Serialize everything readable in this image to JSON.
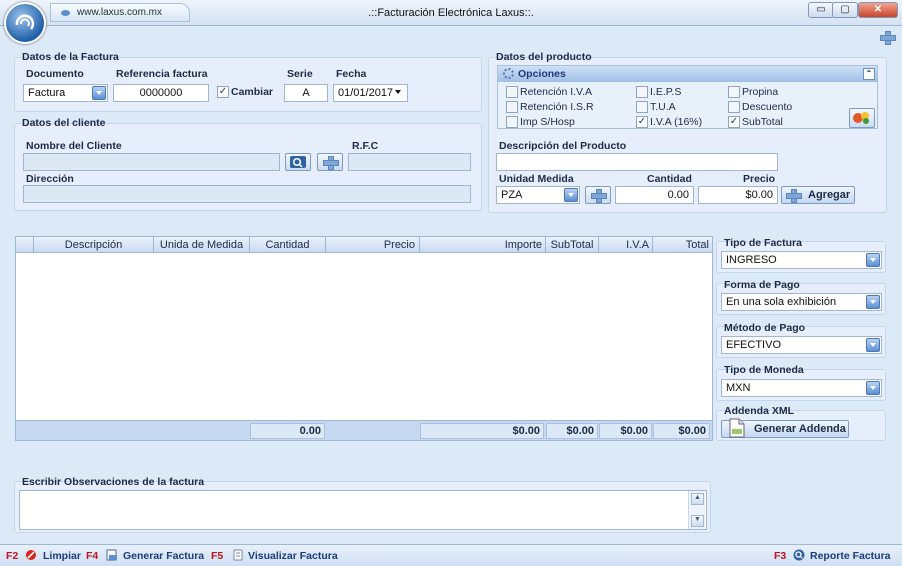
{
  "window": {
    "url": "www.laxus.com.mx",
    "title": ".::Facturación Electrónica Laxus::.",
    "minimize": "▭",
    "maximize": "▢",
    "close": "✕"
  },
  "factura": {
    "title": "Datos de la Factura",
    "documento_label": "Documento",
    "documento_value": "Factura",
    "referencia_label": "Referencia factura",
    "referencia_value": "0000000",
    "cambiar_label": "Cambiar",
    "cambiar_checked": true,
    "serie_label": "Serie",
    "serie_value": "A",
    "fecha_label": "Fecha",
    "fecha_value": "01/01/2017"
  },
  "cliente": {
    "title": "Datos del cliente",
    "nombre_label": "Nombre del Cliente",
    "nombre_value": "",
    "rfc_label": "R.F.C",
    "rfc_value": "",
    "direccion_label": "Dirección",
    "direccion_value": ""
  },
  "producto": {
    "title": "Datos del producto",
    "opciones_title": "Opciones",
    "options": [
      {
        "label": "Retención I.V.A",
        "checked": false
      },
      {
        "label": "Retención I.S.R",
        "checked": false
      },
      {
        "label": "Imp S/Hosp",
        "checked": false
      },
      {
        "label": "I.E.P.S",
        "checked": false
      },
      {
        "label": "T.U.A",
        "checked": false
      },
      {
        "label": "I.V.A (16%)",
        "checked": true
      },
      {
        "label": "Propina",
        "checked": false
      },
      {
        "label": "Descuento",
        "checked": false
      },
      {
        "label": "SubTotal",
        "checked": true
      }
    ],
    "descripcion_label": "Descripción del Producto",
    "descripcion_value": "",
    "unidad_label": "Unidad Medida",
    "unidad_value": "PZA",
    "cantidad_label": "Cantidad",
    "cantidad_value": "0.00",
    "precio_label": "Precio",
    "precio_value": "$0.00",
    "agregar_label": "Agregar"
  },
  "table": {
    "columns": [
      "Descripción",
      "Unida de Medida",
      "Cantidad",
      "Precio",
      "Importe",
      "SubTotal",
      "I.V.A",
      "Total"
    ],
    "rows": [],
    "totals": {
      "cantidad": "0.00",
      "importe": "$0.00",
      "subtotal": "$0.00",
      "iva": "$0.00",
      "total": "$0.00"
    }
  },
  "side": {
    "tipo_factura_label": "Tipo de Factura",
    "tipo_factura_value": "INGRESO",
    "forma_pago_label": "Forma de Pago",
    "forma_pago_value": "En una sola exhibición",
    "metodo_pago_label": "Método de Pago",
    "metodo_pago_value": "EFECTIVO",
    "moneda_label": "Tipo de Moneda",
    "moneda_value": "MXN",
    "addenda_label": "Addenda XML",
    "addenda_button": "Generar Addenda"
  },
  "observaciones": {
    "title": "Escribir Observaciones de la factura",
    "value": ""
  },
  "status": {
    "f2_key": "F2",
    "f2_label": "Limpiar",
    "f4_key": "F4",
    "f4_label": "Generar Factura",
    "f5_key": "F5",
    "f5_label": "Visualizar Factura",
    "f3_key": "F3",
    "f3_label": "Reporte Factura"
  },
  "colors": {
    "background": "#dce9f7",
    "accent": "#5b8fd1",
    "hotkey": "#c0121b"
  }
}
